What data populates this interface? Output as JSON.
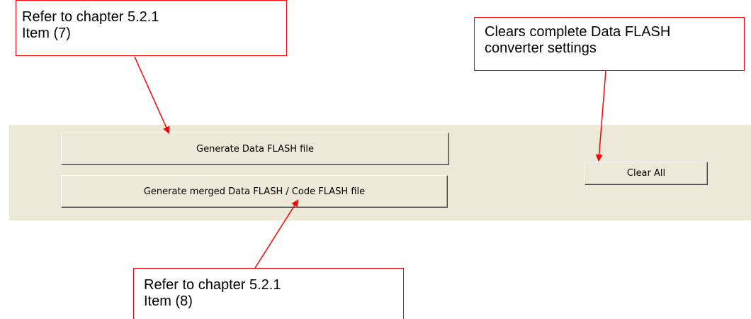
{
  "buttons": {
    "generate_data_flash": "Generate Data FLASH file",
    "generate_merged": "Generate merged Data FLASH / Code FLASH file",
    "clear_all": "Clear All"
  },
  "callouts": {
    "top_left": "Refer to chapter 5.2.1\nItem (7)",
    "top_right": "Clears complete Data FLASH\nconverter settings",
    "bottom": "Refer to chapter 5.2.1\nItem (8)"
  },
  "colors": {
    "panel_background": "#ece9d8",
    "callout_border": "#ff0000",
    "arrow": "#ff0000"
  }
}
